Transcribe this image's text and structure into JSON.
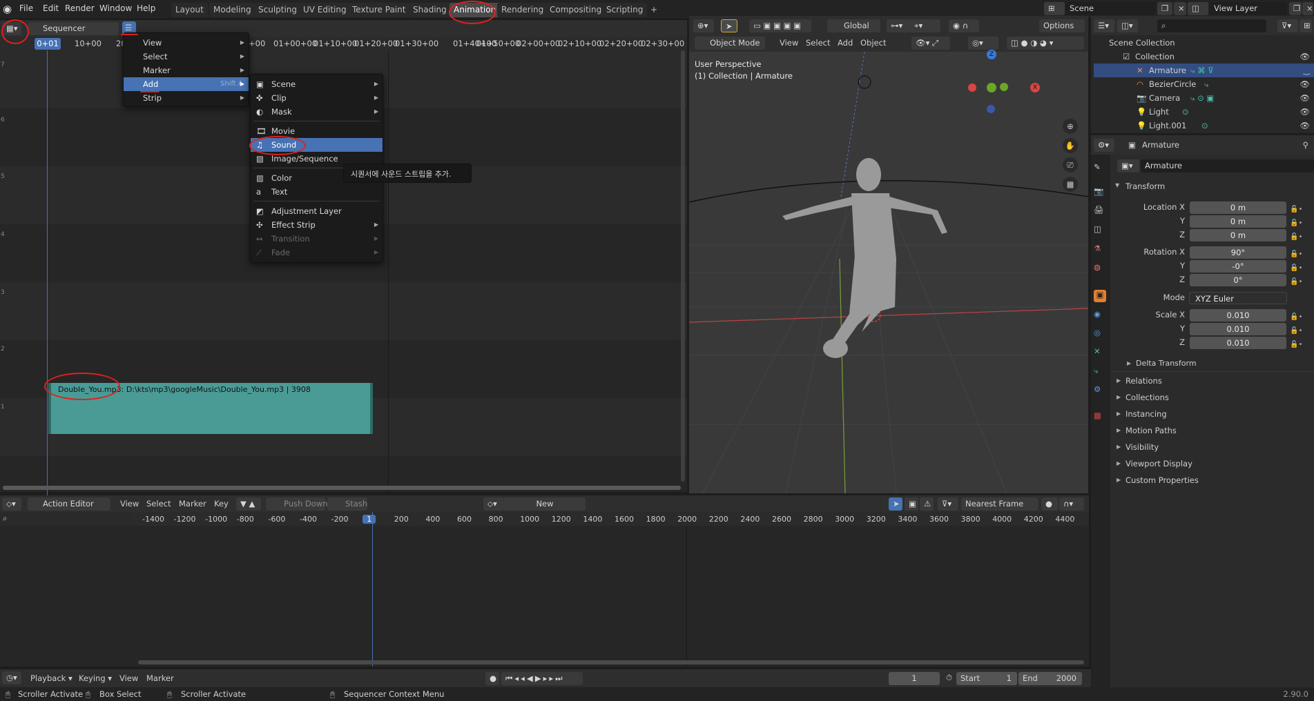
{
  "topmenu": {
    "file": "File",
    "edit": "Edit",
    "render": "Render",
    "window": "Window",
    "help": "Help"
  },
  "workspaces": [
    "Layout",
    "Modeling",
    "Sculpting",
    "UV Editing",
    "Texture Paint",
    "Shading",
    "Animation",
    "Rendering",
    "Compositing",
    "Scripting",
    "+"
  ],
  "scene": {
    "name": "Scene",
    "view_layer": "View Layer"
  },
  "sequencer": {
    "editor_label": "Sequencer",
    "current_frame": "0+01",
    "ruler": [
      "10+00",
      "20",
      "+00",
      "01+00+00",
      "01+10+00",
      "01+20+00",
      "01+30+00",
      "01+40+00",
      "01+50+00",
      "02+00+00",
      "02+10+00",
      "02+20+00",
      "02+30+00"
    ],
    "view_menu": [
      {
        "label": "View"
      },
      {
        "label": "Select"
      },
      {
        "label": "Marker"
      },
      {
        "label": "Add",
        "shortcut": "Shift A"
      },
      {
        "label": "Strip"
      }
    ],
    "add_menu": [
      {
        "label": "Scene",
        "sub": true
      },
      {
        "label": "Clip",
        "sub": true
      },
      {
        "label": "Mask",
        "sub": true
      },
      {
        "label": "Movie"
      },
      {
        "label": "Sound"
      },
      {
        "label": "Image/Sequence"
      },
      {
        "label": "Color"
      },
      {
        "label": "Text"
      },
      {
        "label": "Adjustment Layer"
      },
      {
        "label": "Effect Strip",
        "sub": true
      },
      {
        "label": "Transition",
        "sub": true,
        "disabled": true
      },
      {
        "label": "Fade",
        "sub": true,
        "disabled": true
      }
    ],
    "tooltip": "시퀀서에 사운드 스트립을 추가.",
    "strip_label": "Double_You.mp3: D:\\kts\\mp3\\googleMusic\\Double_You.mp3 | 3908",
    "channel_numbers": [
      "7",
      "6",
      "5",
      "4",
      "3",
      "2",
      "1"
    ]
  },
  "viewport": {
    "transform": "Global",
    "options": "Options",
    "mode": "Object Mode",
    "menus": [
      "View",
      "Select",
      "Add",
      "Object"
    ],
    "info1": "User Perspective",
    "info2": "(1) Collection | Armature"
  },
  "outliner": {
    "title": "Scene Collection",
    "items": [
      {
        "label": "Collection",
        "indent": 1
      },
      {
        "label": "Armature",
        "indent": 2,
        "selected": true
      },
      {
        "label": "BezierCircle",
        "indent": 2
      },
      {
        "label": "Camera",
        "indent": 2
      },
      {
        "label": "Light",
        "indent": 2
      },
      {
        "label": "Light.001",
        "indent": 2
      }
    ]
  },
  "properties": {
    "object": "Armature",
    "name_field": "Armature",
    "transform_label": "Transform",
    "rows": [
      {
        "label": "Location X",
        "value": "0 m"
      },
      {
        "label": "Y",
        "value": "0 m"
      },
      {
        "label": "Z",
        "value": "0 m"
      },
      {
        "label": "Rotation X",
        "value": "90°"
      },
      {
        "label": "Y",
        "value": "-0°"
      },
      {
        "label": "Z",
        "value": "0°"
      },
      {
        "label": "Mode",
        "value": "XYZ Euler"
      },
      {
        "label": "Scale X",
        "value": "0.010"
      },
      {
        "label": "Y",
        "value": "0.010"
      },
      {
        "label": "Z",
        "value": "0.010"
      }
    ],
    "delta": "Delta Transform",
    "panels": [
      "Relations",
      "Collections",
      "Instancing",
      "Motion Paths",
      "Visibility",
      "Viewport Display",
      "Custom Properties"
    ]
  },
  "action_editor": {
    "editor": "Action Editor",
    "menus": [
      "View",
      "Select",
      "Marker",
      "Key"
    ],
    "push_down": "Push Down",
    "stash": "Stash",
    "new": "New",
    "snap": "Nearest Frame",
    "ruler": [
      "-1400",
      "-1200",
      "-1000",
      "-800",
      "-600",
      "-400",
      "-200",
      "1",
      "200",
      "400",
      "600",
      "800",
      "1000",
      "1200",
      "1400",
      "1600",
      "1800",
      "2000",
      "2200",
      "2400",
      "2600",
      "2800",
      "3000",
      "3200",
      "3400",
      "3600",
      "3800",
      "4000",
      "4200",
      "4400"
    ]
  },
  "timeline": {
    "menus": [
      "Playback",
      "Keying",
      "View",
      "Marker"
    ],
    "frame": "1",
    "start_label": "Start",
    "start": "1",
    "end_label": "End",
    "end": "2000"
  },
  "statusbar": {
    "items": [
      "Scroller Activate",
      "Box Select",
      "Scroller Activate",
      "Sequencer Context Menu"
    ],
    "version": "2.90.0"
  }
}
